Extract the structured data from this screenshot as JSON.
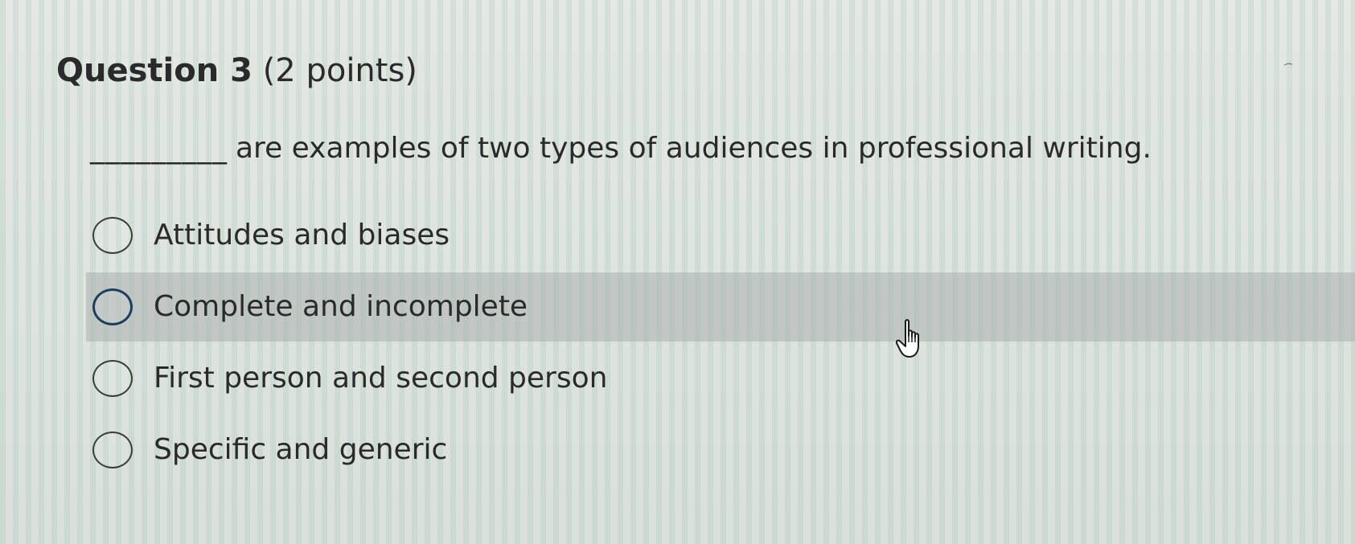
{
  "question": {
    "label": "Question 3",
    "points": "(2 points)",
    "blank": "_________",
    "prompt": "are examples of two types of audiences in professional writing."
  },
  "options": [
    {
      "label": "Attitudes and biases",
      "selected": false,
      "hovered": false
    },
    {
      "label": "Complete and incomplete",
      "selected": false,
      "hovered": true
    },
    {
      "label": "First person and second person",
      "selected": false,
      "hovered": false
    },
    {
      "label": "Specific and generic",
      "selected": false,
      "hovered": false
    }
  ],
  "colors": {
    "hover_row": "#aab0ae",
    "focus_radio": "#1f3f5e",
    "text": "#2a2a2a"
  },
  "icons": {
    "cursor": "hand-pointer-icon",
    "radio": "radio-circle-icon"
  }
}
